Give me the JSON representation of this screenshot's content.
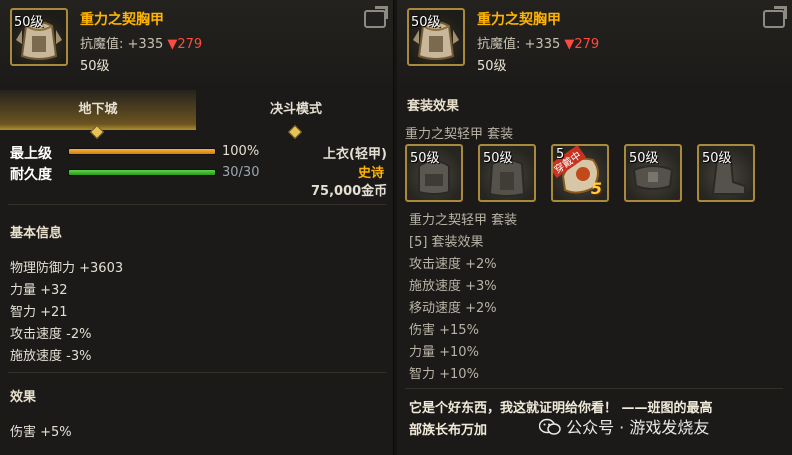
{
  "tooltips": [
    {
      "item_icon": "chest-armor-icon",
      "level_badge": "50级",
      "name": "重力之契胸甲",
      "resist_label": "抗魔值:",
      "resist_up": "+335",
      "resist_down": "▼279",
      "level_text": "50级"
    },
    {
      "item_icon": "chest-armor-icon",
      "level_badge": "50级",
      "name": "重力之契胸甲",
      "resist_label": "抗魔值:",
      "resist_up": "+335",
      "resist_down": "▼279",
      "level_text": "50级"
    }
  ],
  "tabs": [
    "地下城",
    "决斗模式"
  ],
  "stats": {
    "max_level_label": "最上级",
    "max_level_value": "100%",
    "max_level_fraction": 1.0,
    "durability_label": "耐久度",
    "durability_value": "30/30",
    "durability_fraction": 1.0,
    "slot_type": "上衣(轻甲)",
    "rarity": "史诗",
    "price": "75,000金币"
  },
  "colors": {
    "gold": "#ffb400",
    "epic": "#ffb400",
    "bar_orange": "#f29a17",
    "bar_green": "#3dbd2a",
    "down_red": "#ff4b3e"
  },
  "basic_info": {
    "title": "基本信息",
    "lines": [
      "物理防御力 +3603",
      "力量 +32",
      "智力 +21",
      "攻击速度 -2%",
      "施放速度 -3%"
    ]
  },
  "effect": {
    "title": "效果",
    "lines": [
      "伤害 +5%"
    ]
  },
  "set_effect": {
    "title": "套装效果",
    "set_name": "重力之契轻甲 套装",
    "pieces": [
      {
        "level": "50级",
        "icon": "helmet-armor-icon"
      },
      {
        "level": "50级",
        "icon": "chest-armor-icon"
      },
      {
        "level": "5",
        "icon": "shoulder-armor-icon",
        "equipped": "穿戴中",
        "count": "5"
      },
      {
        "level": "50级",
        "icon": "belt-armor-icon"
      },
      {
        "level": "50级",
        "icon": "boots-armor-icon"
      }
    ],
    "detail_name": "重力之契轻甲 套装",
    "detail_lines": [
      "[5] 套装效果",
      "攻击速度 +2%",
      "施放速度 +3%",
      "移动速度 +2%",
      "伤害 +15%",
      "力量 +10%",
      "智力 +10%"
    ]
  },
  "quote": {
    "line1": "它是个好东西，我这就证明给你看！ ——班图的最高",
    "line2": "部族长布万加"
  },
  "watermark": "公众号 · 游戏发烧友"
}
